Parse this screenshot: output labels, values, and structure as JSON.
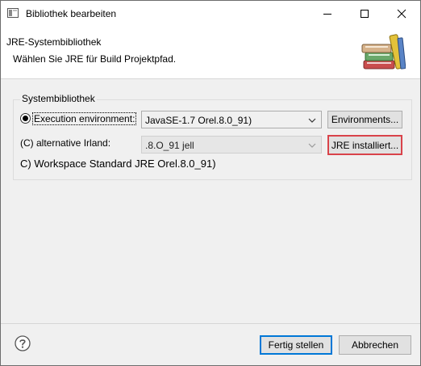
{
  "window": {
    "title": "Bibliothek bearbeiten",
    "icons": {
      "app": "library-window-icon",
      "minimize": "minimize-icon",
      "maximize": "maximize-icon",
      "close": "close-icon"
    }
  },
  "header": {
    "title": "JRE-Systembibliothek",
    "description": "Wählen Sie JRE für Build Projektpfad.",
    "art_icon": "books-icon"
  },
  "group": {
    "label": "Systembibliothek",
    "options": [
      {
        "label": "Execution environment:",
        "selected": true,
        "combo_value": "JavaSE-1.7 Orel.8.0_91)",
        "button_label": "Environments..."
      },
      {
        "label": "(C) alternative Irland:",
        "selected": false,
        "combo_value": ".8.O_91 jell",
        "button_label": "JRE installiert..."
      },
      {
        "label": "C) Workspace Standard JRE Orel.8.0_91)"
      }
    ]
  },
  "footer": {
    "help_icon": "help-icon",
    "finish_label": "Fertig stellen",
    "cancel_label": "Abbrechen"
  },
  "colors": {
    "highlight": "#d9434a",
    "default_button_border": "#0078d7"
  }
}
